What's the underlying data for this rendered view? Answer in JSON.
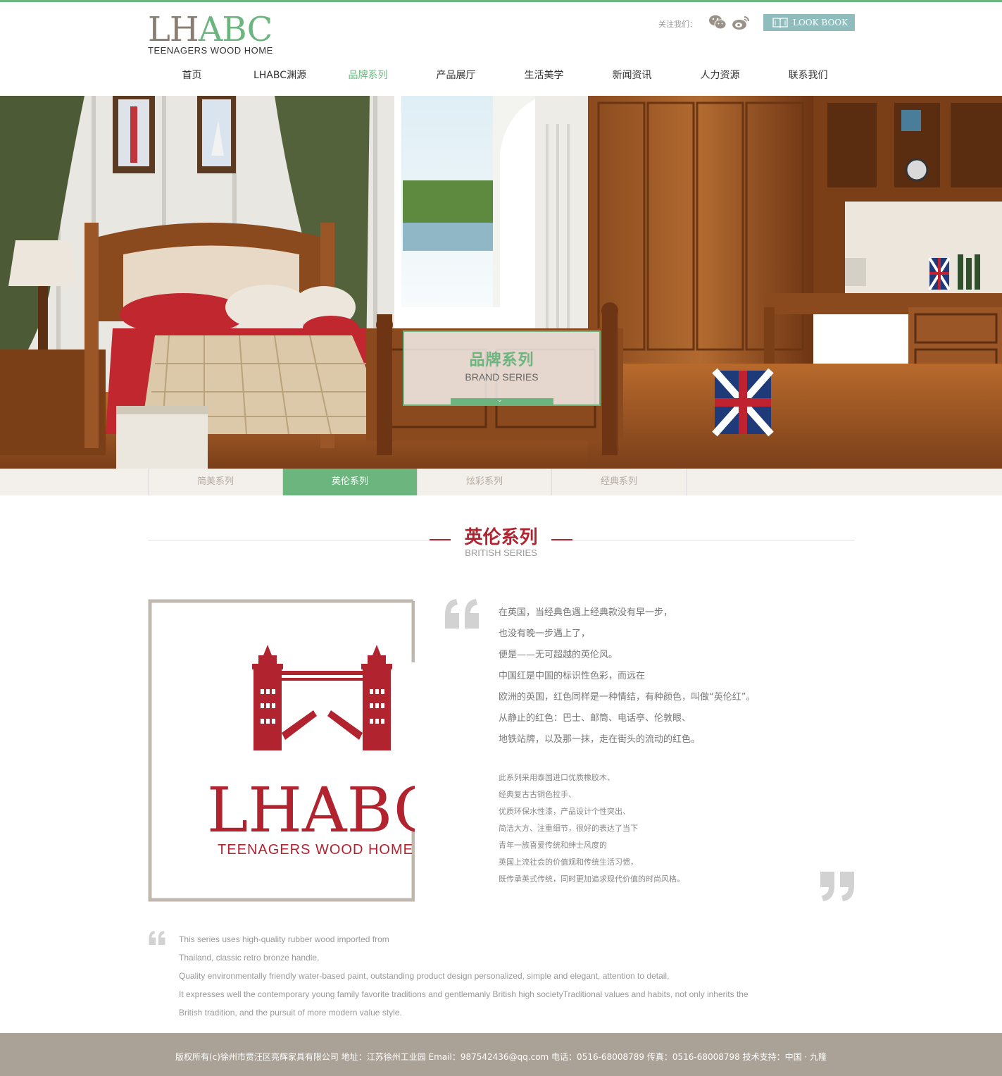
{
  "header": {
    "logo_main_left": "LH",
    "logo_main_right": "ABC",
    "logo_sub": "TEENAGERS WOOD HOME",
    "follow_label": "关注我们：",
    "lookbook_label": "LOOK BOOK",
    "icons": [
      "wechat-icon",
      "weibo-icon",
      "book-icon"
    ]
  },
  "nav": {
    "items": [
      {
        "label": "首页"
      },
      {
        "label": "LHABC渊源"
      },
      {
        "label": "品牌系列",
        "active": true
      },
      {
        "label": "产品展厅"
      },
      {
        "label": "生活美学"
      },
      {
        "label": "新闻资讯"
      },
      {
        "label": "人力资源"
      },
      {
        "label": "联系我们"
      }
    ]
  },
  "hero": {
    "title_cn": "品牌系列",
    "title_en": "BRAND SERIES",
    "chevron": "⌄"
  },
  "tabs": {
    "items": [
      {
        "label": "简美系列"
      },
      {
        "label": "英伦系列",
        "active": true
      },
      {
        "label": "炫彩系列"
      },
      {
        "label": "经典系列"
      }
    ]
  },
  "section": {
    "title": "英伦系列",
    "subtitle": "BRITISH SERIES"
  },
  "brand_logo": {
    "main": "LHABC",
    "sub": "TEENAGERS WOOD HOME",
    "color": "#b1232f"
  },
  "content": {
    "cn_para1": [
      "在英国，当经典色遇上经典款没有早一步，",
      "也没有晚一步遇上了，",
      "便是——无可超越的英伦风。",
      "中国红是中国的标识性色彩，而远在",
      "欧洲的英国，红色同样是一种情结，有种颜色，叫做“英伦红”。",
      "从静止的红色：巴士、邮筒、电话亭、伦敦眼、",
      "地铁站牌，以及那一抹，走在街头的流动的红色。"
    ],
    "cn_para2": [
      "此系列采用泰国进口优质橡胶木、",
      "经典复古古铜色拉手、",
      "优质环保水性漆，产品设计个性突出、",
      "简洁大方、注重细节，很好的表达了当下",
      "青年一族喜爱传统和绅士风度的",
      "英国上流社会的价值观和传统生活习惯，",
      "既传承英式传统，同时更加追求现代价值的时尚风格。"
    ],
    "en_para": [
      "This series uses high-quality rubber wood imported from",
      "Thailand, classic retro bronze handle,",
      "Quality environmentally friendly water-based paint, outstanding product design personalized, simple and elegant, attention to detail,",
      "It expresses well the contemporary young family favorite traditions and gentlemanly British high societyTraditional values and habits, not only inherits the",
      "British tradition, and the pursuit of more modern value style."
    ]
  },
  "footer": {
    "text": "版权所有(c)徐州市贾汪区亮辉家具有限公司    地址：江苏徐州工业园    Email：987542436@qq.com    电话：0516-68008789    传真：0516-68008798    技术支持：中国 · 九隆"
  },
  "colors": {
    "accent_green": "#6cb57f",
    "brand_red": "#b1232f",
    "footer_bg": "#aaa197",
    "lookbook_bg": "#8fbdbd"
  }
}
